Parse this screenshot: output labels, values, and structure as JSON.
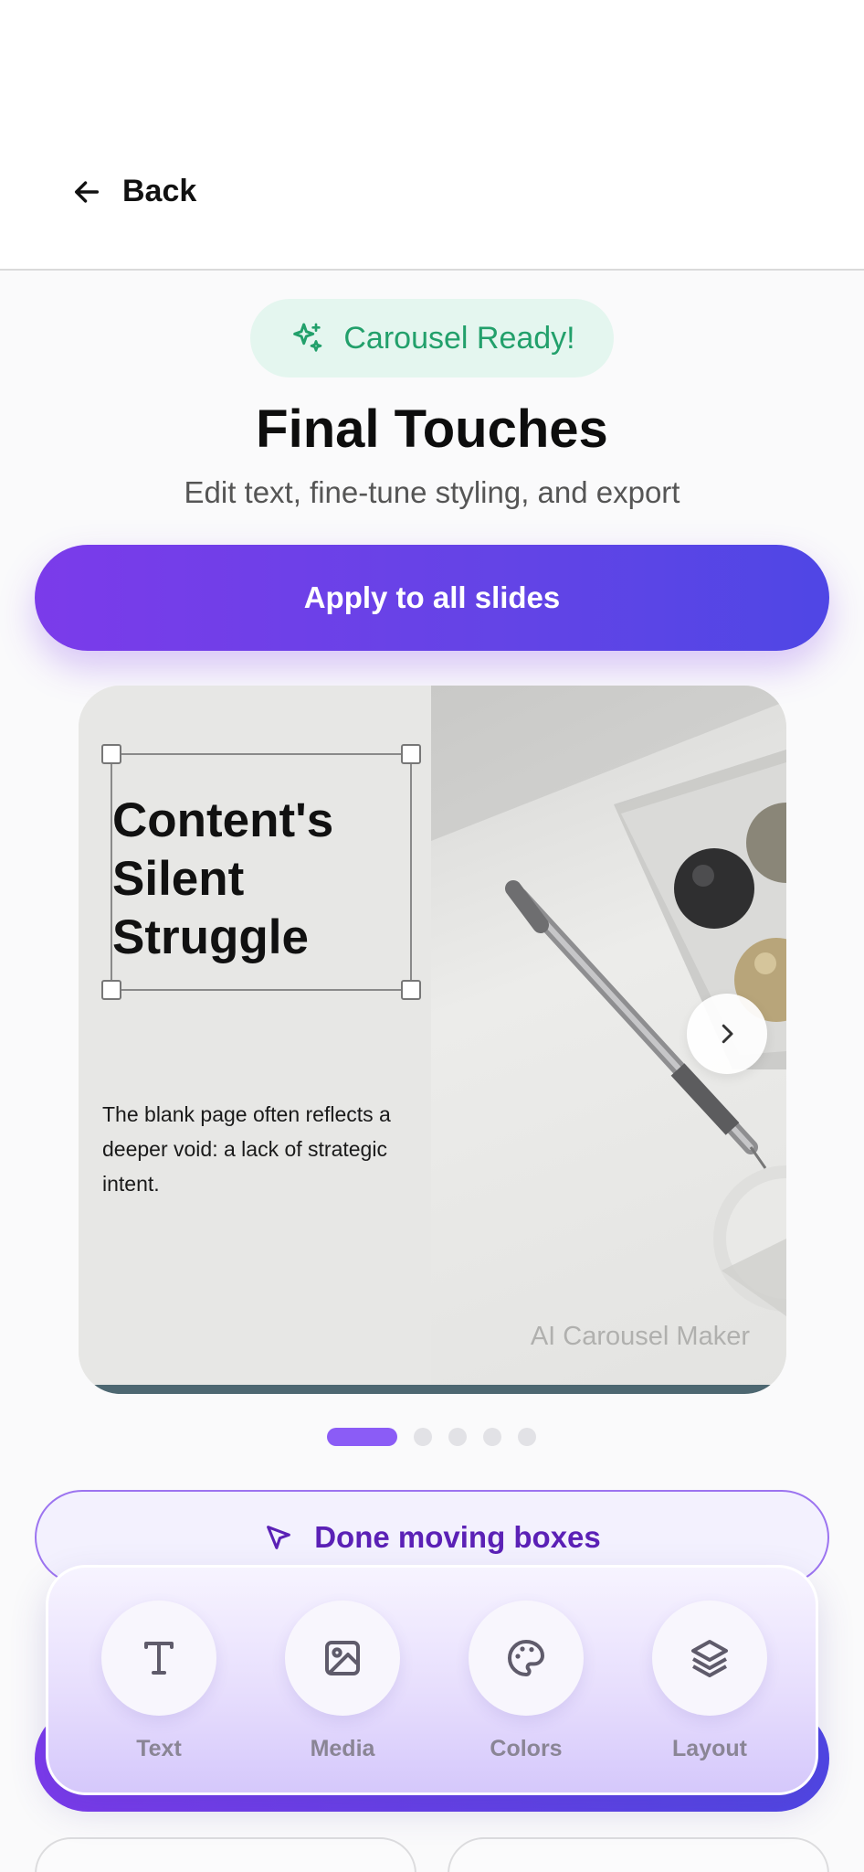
{
  "header": {
    "back_label": "Back"
  },
  "badge": {
    "label": "Carousel Ready!"
  },
  "title": "Final Touches",
  "subtitle": "Edit text, fine-tune styling, and export",
  "apply_button": {
    "label": "Apply to all slides"
  },
  "slide": {
    "headline": "Content's\nSilent\nStruggle",
    "body": "The blank page often reflects a deeper void: a lack of strategic intent.",
    "watermark": "AI Carousel Maker"
  },
  "pagination": {
    "total": 5,
    "active": 1
  },
  "done_button": {
    "label": "Done moving boxes"
  },
  "toolbar": {
    "items": [
      {
        "label": "Text",
        "icon": "text-icon"
      },
      {
        "label": "Media",
        "icon": "image-icon"
      },
      {
        "label": "Colors",
        "icon": "palette-icon"
      },
      {
        "label": "Layout",
        "icon": "layers-icon"
      }
    ]
  },
  "colors": {
    "accent": "#7c3aed",
    "accent_end": "#4f46e5",
    "success": "#22a06b",
    "success_bg": "#e4f6ef"
  }
}
